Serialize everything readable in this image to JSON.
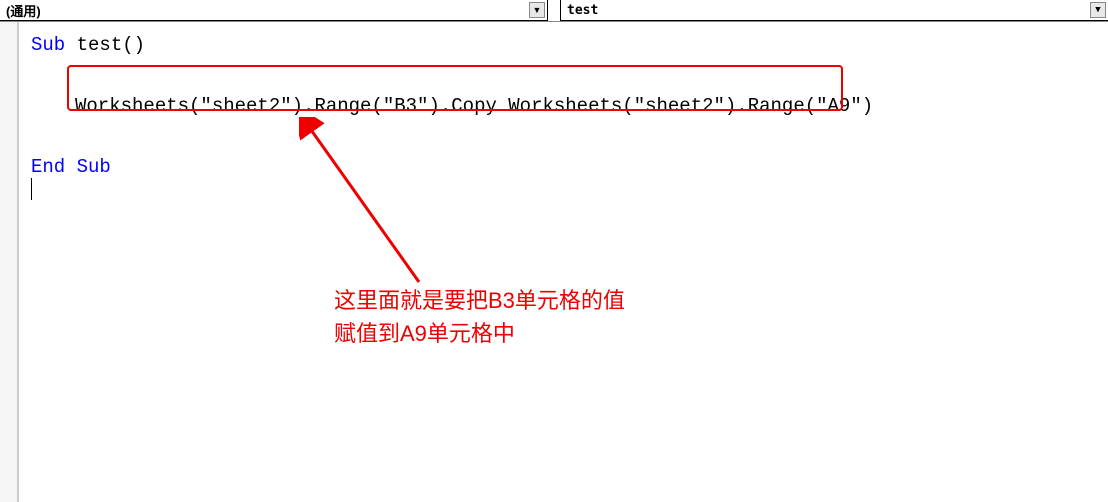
{
  "topbar": {
    "left_dropdown": "(通用)",
    "right_dropdown": "test"
  },
  "code": {
    "line1_kw": "Sub",
    "line1_name": " test()",
    "highlighted_line": "Worksheets(\"sheet2\").Range(\"B3\").Copy Worksheets(\"sheet2\").Range(\"A9\")",
    "line3_kw": "End Sub"
  },
  "annotation": {
    "line1": "这里面就是要把B3单元格的值",
    "line2": "赋值到A9单元格中"
  }
}
